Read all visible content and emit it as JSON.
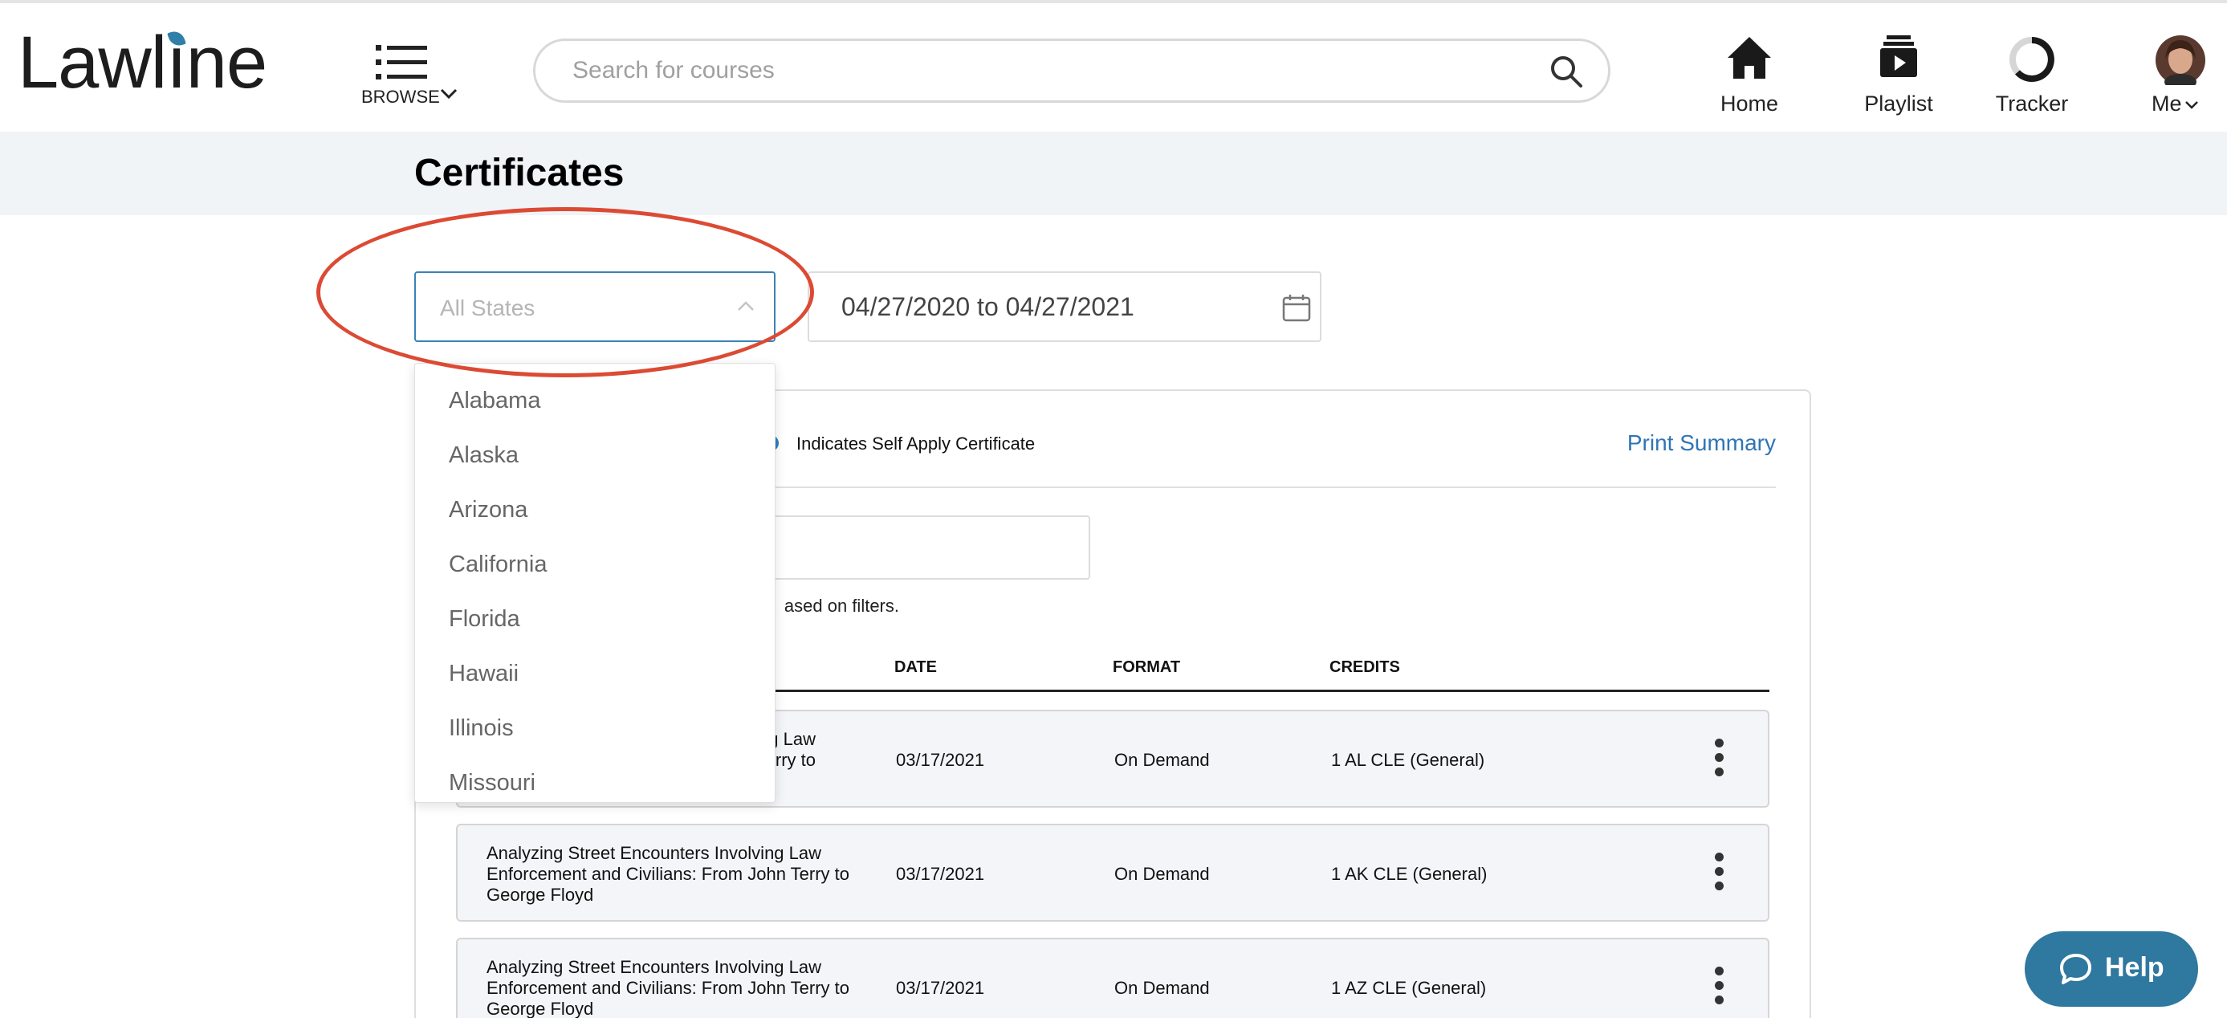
{
  "header": {
    "logo": "Lawline",
    "browse_label": "BROWSE",
    "search_placeholder": "Search for courses",
    "nav": {
      "home": "Home",
      "playlist": "Playlist",
      "tracker": "Tracker",
      "me": "Me"
    }
  },
  "page": {
    "title": "Certificates"
  },
  "filters": {
    "state_placeholder": "All States",
    "date_range": "04/27/2020 to 04/27/2021"
  },
  "state_dropdown": {
    "options": [
      "Alabama",
      "Alaska",
      "Arizona",
      "California",
      "Florida",
      "Hawaii",
      "Illinois",
      "Missouri"
    ]
  },
  "card": {
    "legend_text": "Indicates Self Apply Certificate",
    "print_summary": "Print Summary",
    "results_note": "ased on filters.",
    "columns": {
      "date": "DATE",
      "format": "FORMAT",
      "credits": "CREDITS"
    },
    "rows": [
      {
        "title": "g Law\nn Terry to",
        "date": "03/17/2021",
        "format": "On Demand",
        "credits": "1 AL CLE (General)"
      },
      {
        "title": "Analyzing Street Encounters Involving Law Enforcement and Civilians: From John Terry to George Floyd",
        "date": "03/17/2021",
        "format": "On Demand",
        "credits": "1 AK CLE (General)"
      },
      {
        "title": "Analyzing Street Encounters Involving Law Enforcement and Civilians: From John Terry to George Floyd",
        "date": "03/17/2021",
        "format": "On Demand",
        "credits": "1 AZ CLE (General)"
      }
    ]
  },
  "help": {
    "label": "Help"
  },
  "colors": {
    "accent": "#2f75b5",
    "annotation": "#dc4a34",
    "help_bg": "#2f789f"
  }
}
